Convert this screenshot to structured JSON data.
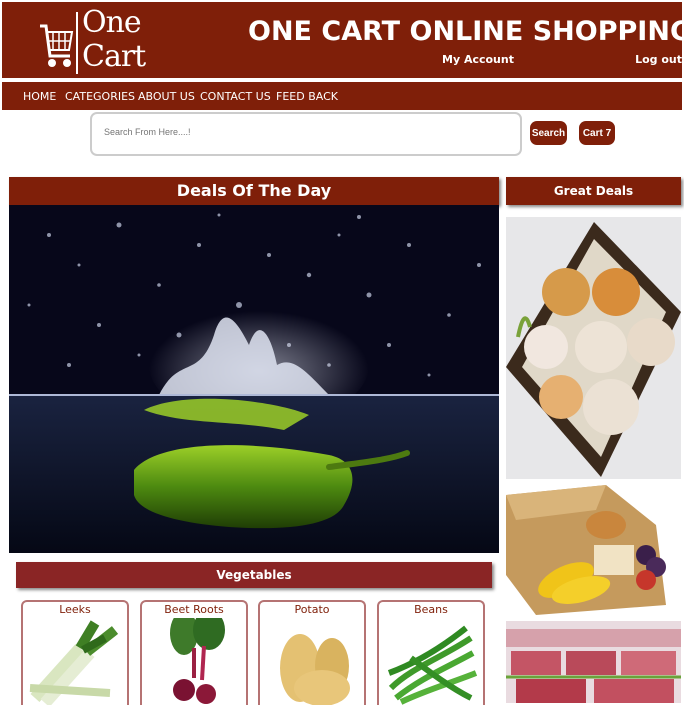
{
  "header": {
    "logo_line1": "One",
    "logo_line2": "Cart",
    "site_title": "ONE CART ONLINE SHOPPING",
    "my_account": "My Account",
    "log_out": "Log out"
  },
  "nav": {
    "items": [
      "HOME",
      "CATEGORIES",
      "ABOUT US",
      "CONTACT US",
      "FEED BACK"
    ]
  },
  "search": {
    "placeholder": "Search From Here....!",
    "button_label": "Search",
    "cart_label": "Cart 7"
  },
  "deals": {
    "title": "Deals Of The Day"
  },
  "great_deals": {
    "title": "Great Deals"
  },
  "vegetables": {
    "title": "Vegetables",
    "products": [
      {
        "name": "Leeks"
      },
      {
        "name": "Beet Roots"
      },
      {
        "name": "Potato"
      },
      {
        "name": "Beans"
      }
    ]
  },
  "colors": {
    "brand": "#7f1f09",
    "section_bar": "#8a2525",
    "card_border": "#b57373"
  }
}
